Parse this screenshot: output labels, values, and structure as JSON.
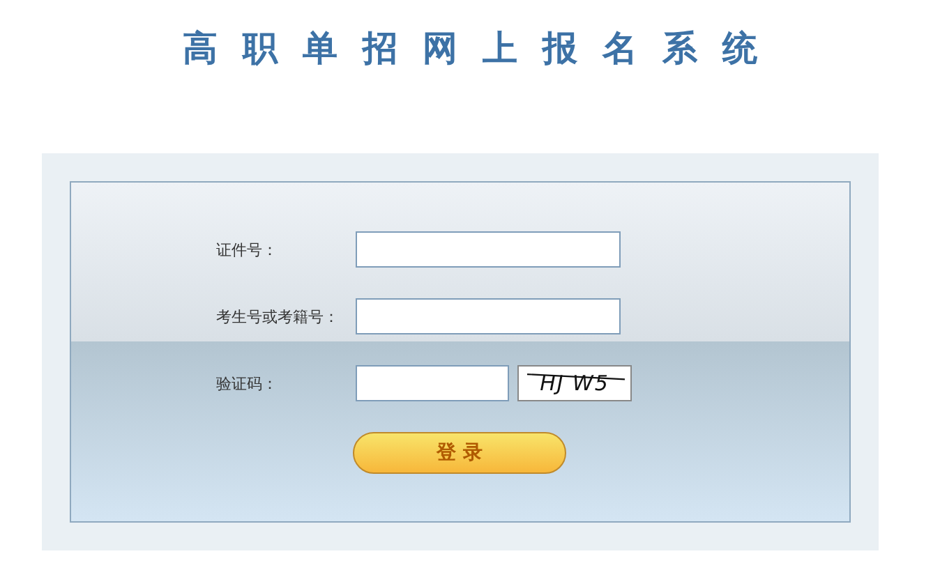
{
  "title": "高职单招网上报名系统",
  "fields": [
    {
      "label": "证件号：",
      "kind": "text"
    },
    {
      "label": "考生号或考籍号：",
      "kind": "text"
    },
    {
      "label": "验证码：",
      "kind": "captcha",
      "captcha": "HJ W5"
    }
  ],
  "button": "登 录"
}
